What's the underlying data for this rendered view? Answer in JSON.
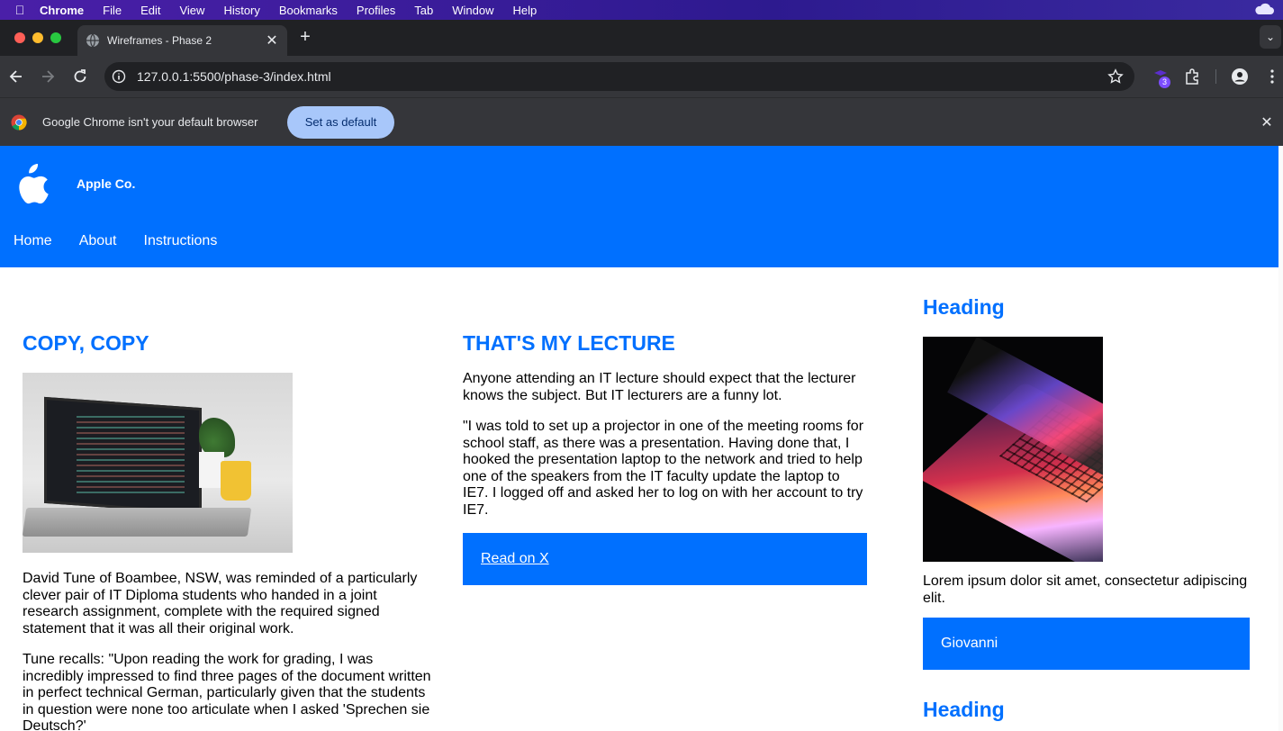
{
  "menubar": {
    "items": [
      "Chrome",
      "File",
      "Edit",
      "View",
      "History",
      "Bookmarks",
      "Profiles",
      "Tab",
      "Window",
      "Help"
    ]
  },
  "browser": {
    "tab_title": "Wireframes - Phase 2",
    "url": "127.0.0.1:5500/phase-3/index.html",
    "extension_badge": "3",
    "infobar_message": "Google Chrome isn't your default browser",
    "infobar_button": "Set as default"
  },
  "site": {
    "brand": "Apple Co.",
    "nav": [
      "Home",
      "About",
      "Instructions"
    ],
    "colors": {
      "primary": "#0070ff"
    }
  },
  "col1": {
    "heading": "COPY, COPY",
    "paragraphs": [
      "David Tune of Boambee, NSW, was reminded of a particularly clever pair of IT Diploma students who handed in a joint research assignment, complete with the required signed statement that it was all their original work.",
      "Tune recalls: \"Upon reading the work for grading, I was incredibly impressed to find three pages of the document written in perfect technical German, particularly given that the students in question were none too articulate when I asked 'Sprechen sie Deutsch?'"
    ]
  },
  "col2": {
    "heading": "THAT'S MY LECTURE",
    "paragraphs": [
      "Anyone attending an IT lecture should expect that the lecturer knows the subject. But IT lecturers are a funny lot.",
      "\"I was told to set up a projector in one of the meeting rooms for school staff, as there was a presentation. Having done that, I hooked the presentation laptop to the network and tried to help one of the speakers from the IT faculty update the laptop to IE7. I logged off and asked her to log on with her account to try IE7."
    ],
    "link": "Read on X"
  },
  "col3": {
    "heading": "Heading",
    "text": "Lorem ipsum dolor sit amet, consectetur adipiscing elit.",
    "name": "Giovanni",
    "heading2": "Heading"
  }
}
